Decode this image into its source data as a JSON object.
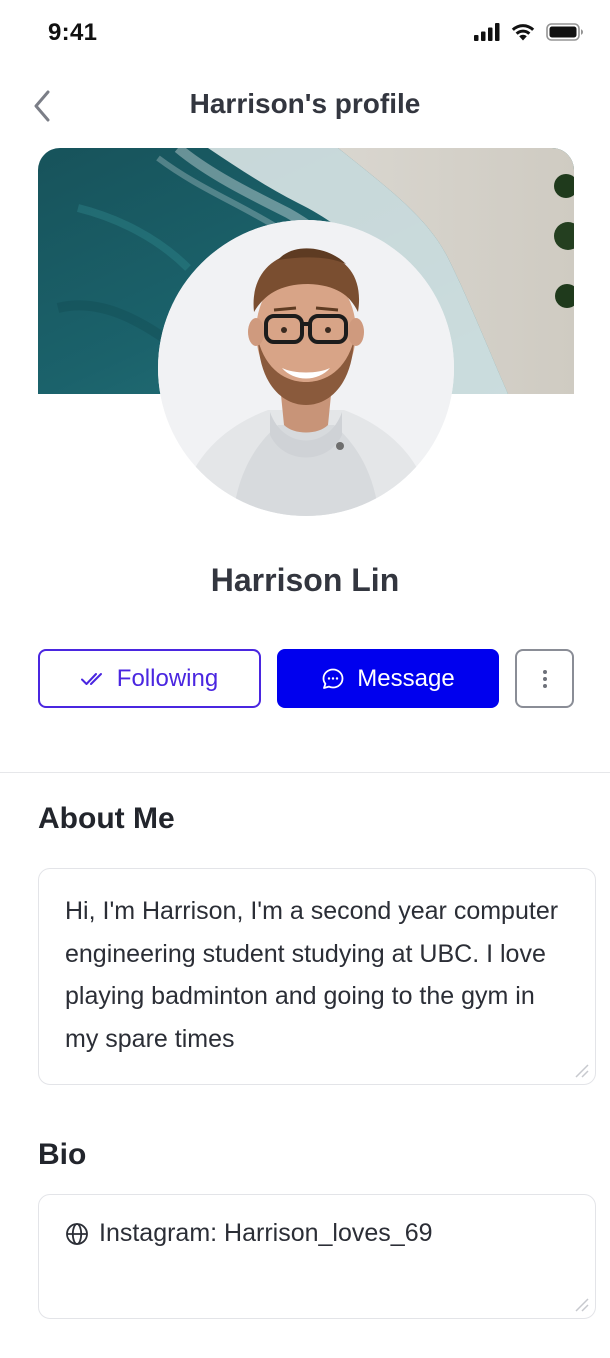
{
  "status_bar": {
    "time": "9:41",
    "icons": [
      "cellular-signal-icon",
      "wifi-icon",
      "battery-icon"
    ]
  },
  "header": {
    "back_icon": "chevron-left-icon",
    "title": "Harrison's profile"
  },
  "profile": {
    "name": "Harrison Lin"
  },
  "actions": {
    "following_label": "Following",
    "following_icon": "double-check-icon",
    "message_label": "Message",
    "message_icon": "chat-bubble-icon",
    "more_icon": "more-vertical-icon"
  },
  "about": {
    "title": "About Me",
    "text": "Hi, I'm Harrison, I'm a second year computer engineering student studying at UBC. I love playing badminton and going to the gym in my spare times"
  },
  "bio": {
    "title": "Bio",
    "icon": "globe-icon",
    "text": "Instagram: Harrison_loves_69"
  },
  "colors": {
    "primary": "#0000ee",
    "following_outline": "#4a26e0",
    "title_text": "#33363f",
    "border": "#e3e4e8"
  }
}
